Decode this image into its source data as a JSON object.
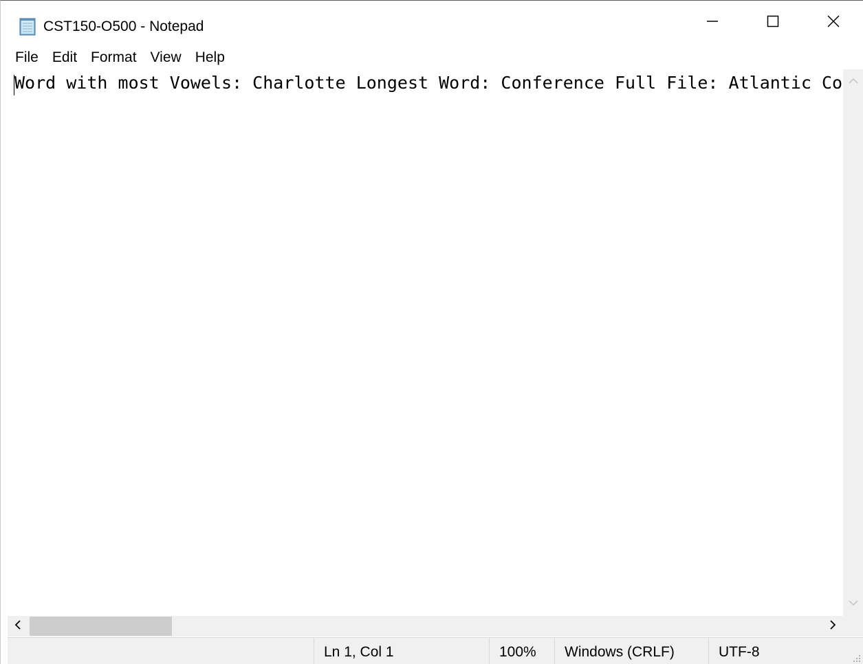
{
  "window": {
    "title": "CST150-O500 - Notepad"
  },
  "menu": {
    "items": [
      "File",
      "Edit",
      "Format",
      "View",
      "Help"
    ]
  },
  "editor": {
    "text": "Word with most Vowels: Charlotte Longest Word: Conference Full File: Atlantic Co"
  },
  "statusbar": {
    "position": "Ln 1, Col 1",
    "zoom": "100%",
    "line_ending": "Windows (CRLF)",
    "encoding": "UTF-8"
  },
  "scroll": {
    "horizontal_position": 0.0,
    "horizontal_thumb_fraction": 0.18
  },
  "icons": {
    "app": "notepad-icon",
    "minimize": "minimize-icon",
    "maximize": "maximize-icon",
    "close": "close-icon"
  }
}
